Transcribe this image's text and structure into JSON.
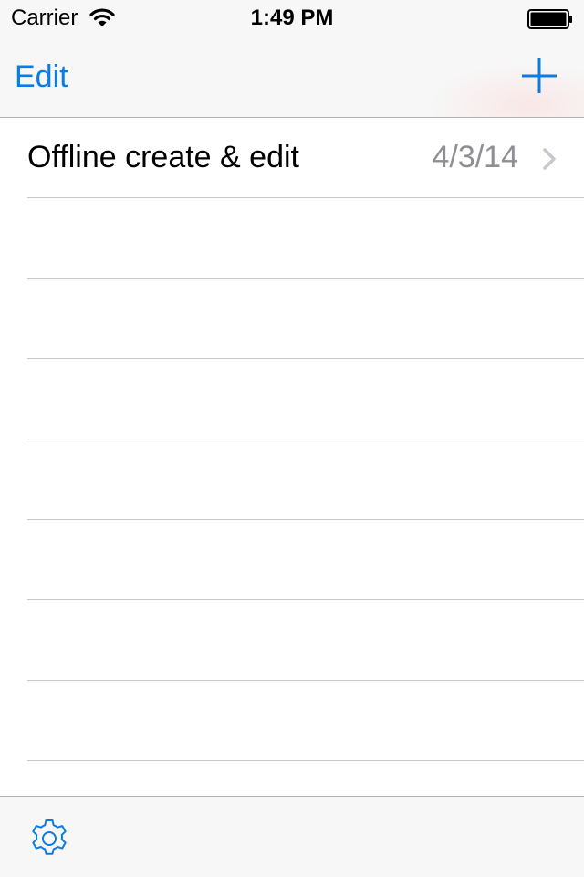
{
  "status_bar": {
    "carrier": "Carrier",
    "time": "1:49 PM",
    "wifi_icon": "wifi-icon",
    "battery_icon": "battery-icon"
  },
  "nav_bar": {
    "edit_label": "Edit",
    "add_icon": "plus-icon"
  },
  "list": {
    "rows": [
      {
        "title": "Offline create & edit",
        "date": "4/3/14",
        "accessory": "chevron-right-icon"
      },
      {
        "title": "",
        "date": ""
      },
      {
        "title": "",
        "date": ""
      },
      {
        "title": "",
        "date": ""
      },
      {
        "title": "",
        "date": ""
      },
      {
        "title": "",
        "date": ""
      },
      {
        "title": "",
        "date": ""
      },
      {
        "title": "",
        "date": ""
      }
    ]
  },
  "toolbar": {
    "settings_icon": "gear-icon"
  },
  "colors": {
    "accent": "#0a7ce6",
    "secondary_text": "#8e8e93",
    "separator": "#c8c7cc",
    "bar_background": "#f7f7f7"
  }
}
